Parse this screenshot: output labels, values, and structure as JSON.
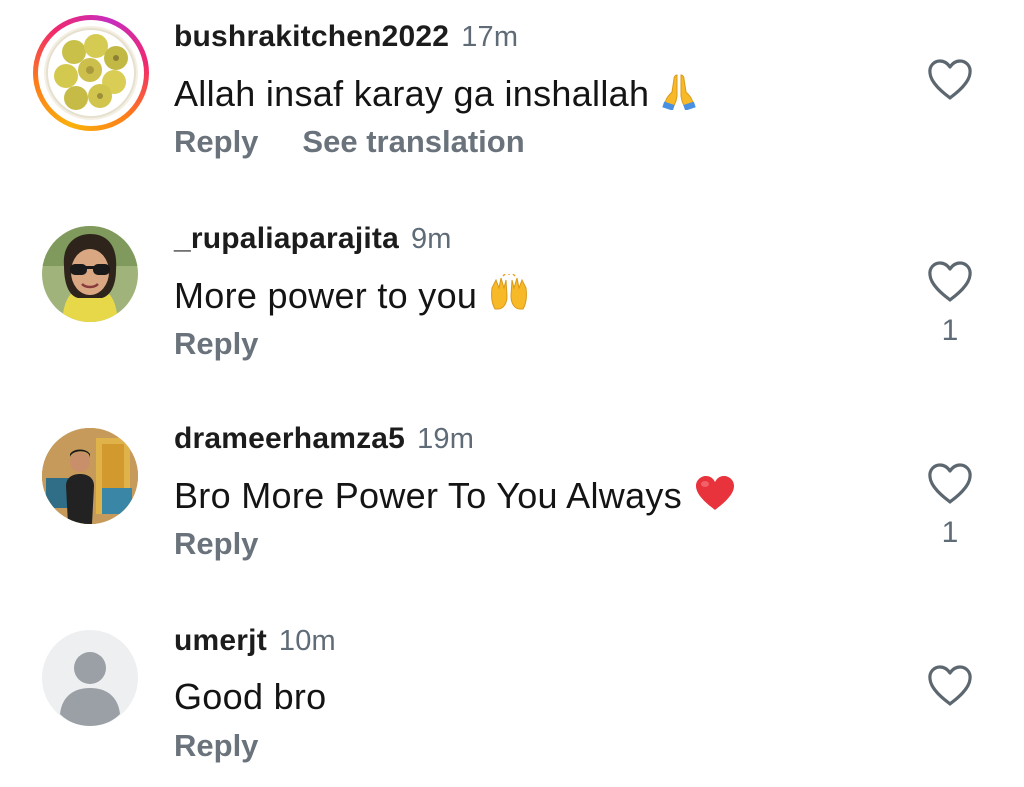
{
  "comments": [
    {
      "username": "bushrakitchen2022",
      "time": "17m",
      "text": "Allah insaf karay ga inshallah",
      "emoji": "folded-hands",
      "reply_label": "Reply",
      "translation_label": "See translation",
      "likes": "",
      "has_story_ring": true
    },
    {
      "username": "_rupaliaparajita",
      "time": "9m",
      "text": "More power to you",
      "emoji": "raising-hands",
      "reply_label": "Reply",
      "likes": "1"
    },
    {
      "username": "drameerhamza5",
      "time": "19m",
      "text": "Bro More Power To You Always",
      "emoji": "red-heart",
      "reply_label": "Reply",
      "likes": "1"
    },
    {
      "username": "umerjt",
      "time": "10m",
      "text": "Good bro",
      "emoji": "",
      "reply_label": "Reply",
      "likes": ""
    }
  ],
  "icons": {
    "like": "heart-outline-icon",
    "default_avatar": "person-silhouette-icon"
  },
  "colors": {
    "text": "#141414",
    "muted": "#6a737c",
    "heart_emoji": "#e8323c",
    "emoji_yellow": "#f7b928"
  }
}
